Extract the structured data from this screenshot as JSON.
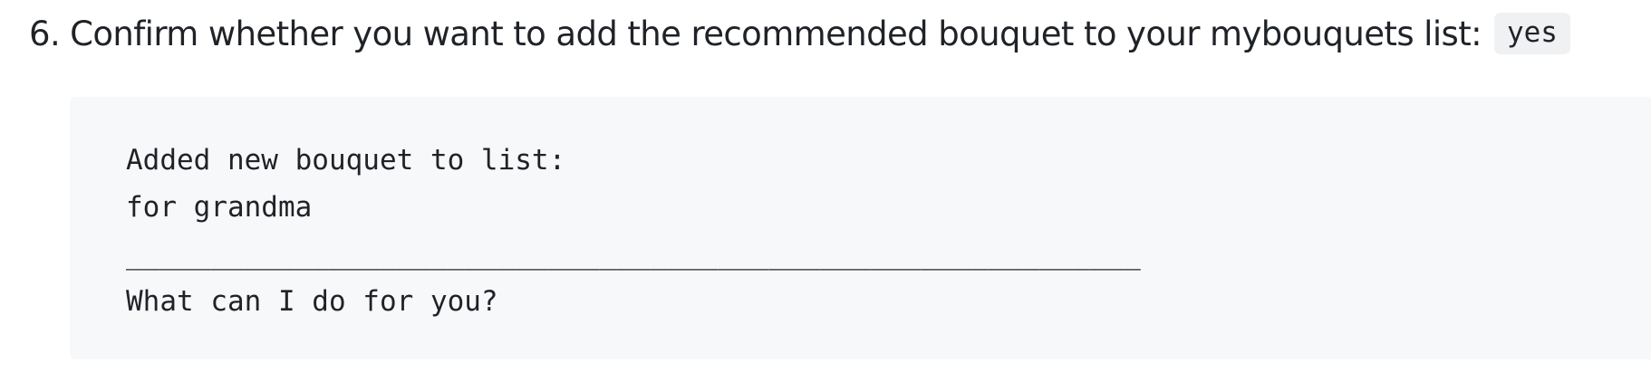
{
  "step": {
    "number": "6.",
    "text": "Confirm whether you want to add the recommended bouquet to your mybouquets list:",
    "input_value": "yes"
  },
  "output": {
    "lines": [
      "Added new bouquet to list:",
      "for grandma"
    ],
    "divider": "____________________________________________________________",
    "prompt": "What can I do for you?"
  }
}
